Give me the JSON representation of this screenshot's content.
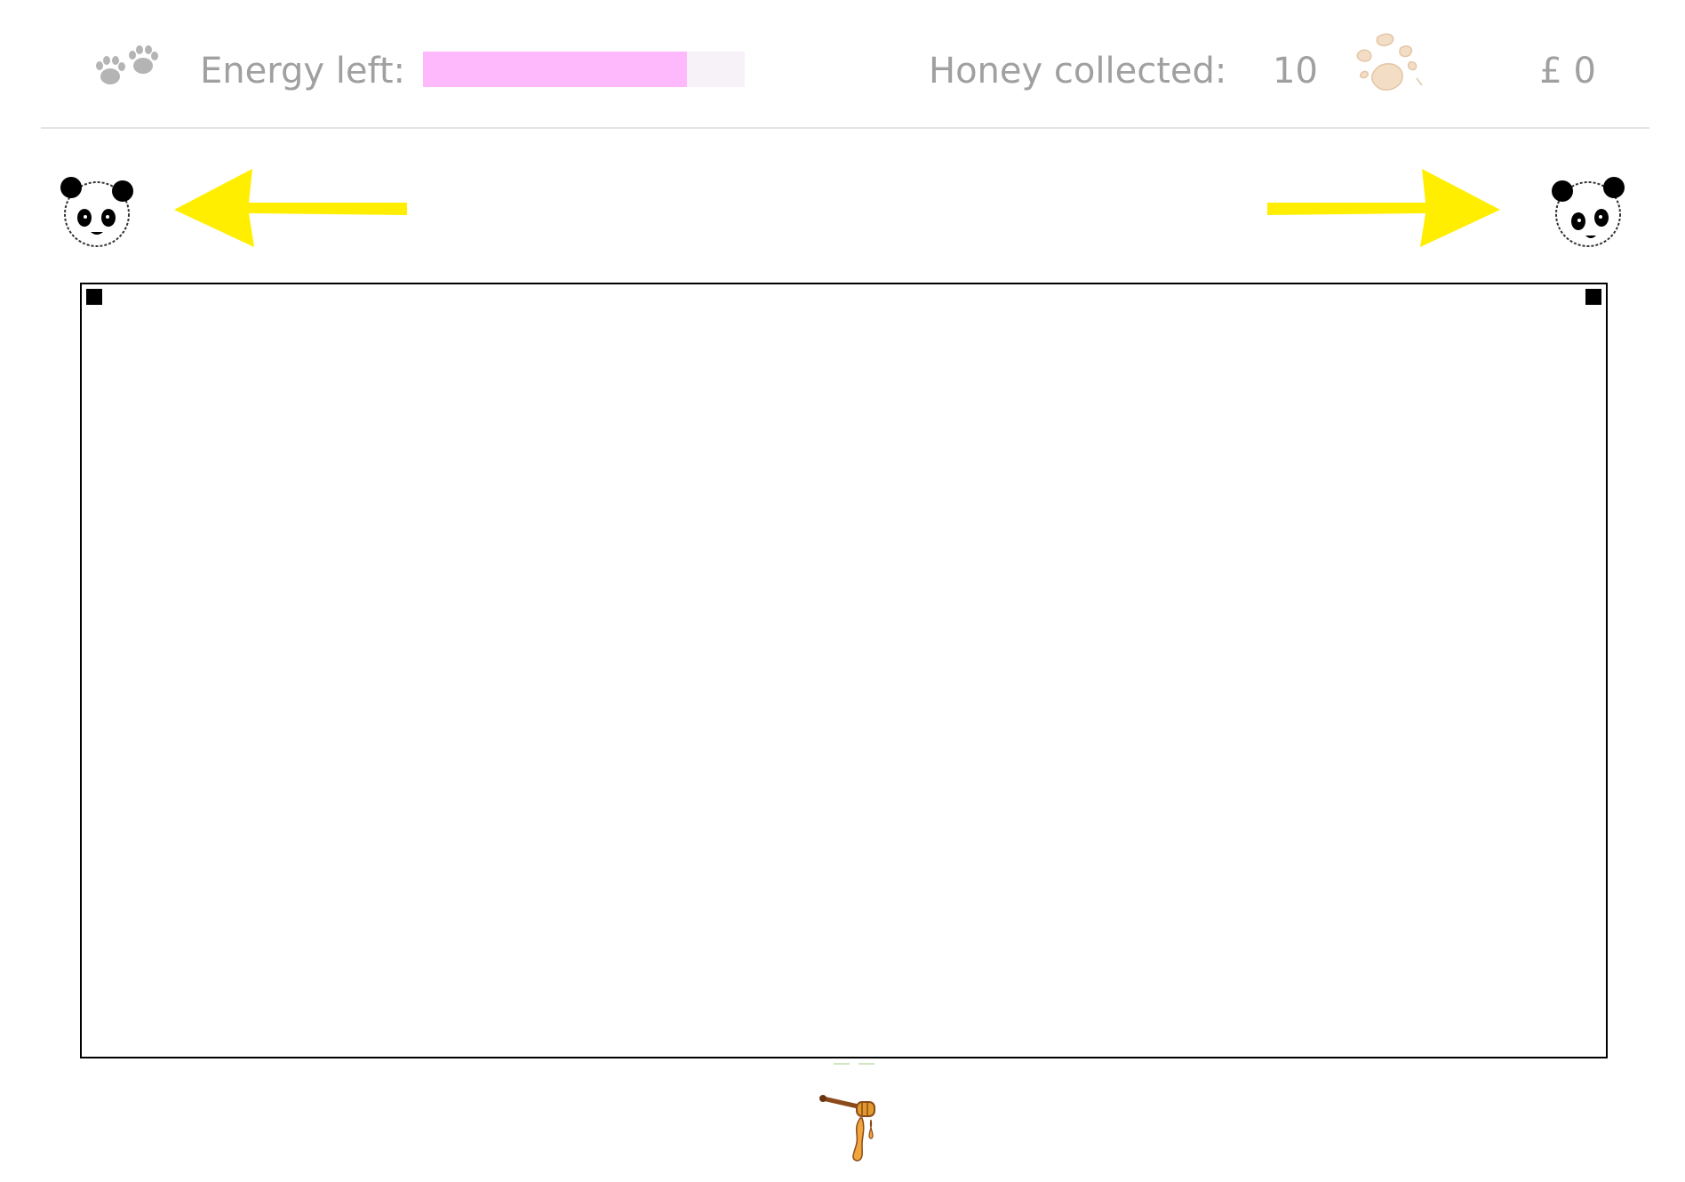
{
  "hud": {
    "paws_icon": "paw-prints-icon",
    "energy_label": "Energy left:",
    "energy_level_fraction": 0.82,
    "energy_color": "#fdb9fb",
    "honey_label": "Honey collected:",
    "honey_count": "10",
    "honey_icon": "honey-splash-icon",
    "money": "£ 0"
  },
  "controls": {
    "left_icon": "panda-face-icon",
    "left_arrow": "arrow-left-icon",
    "right_arrow": "arrow-right-icon",
    "right_icon": "panda-face-icon",
    "arrow_color": "#ffee00"
  },
  "play_area": {
    "border_color": "#000000",
    "player_icon": "honey-dipper-icon"
  }
}
